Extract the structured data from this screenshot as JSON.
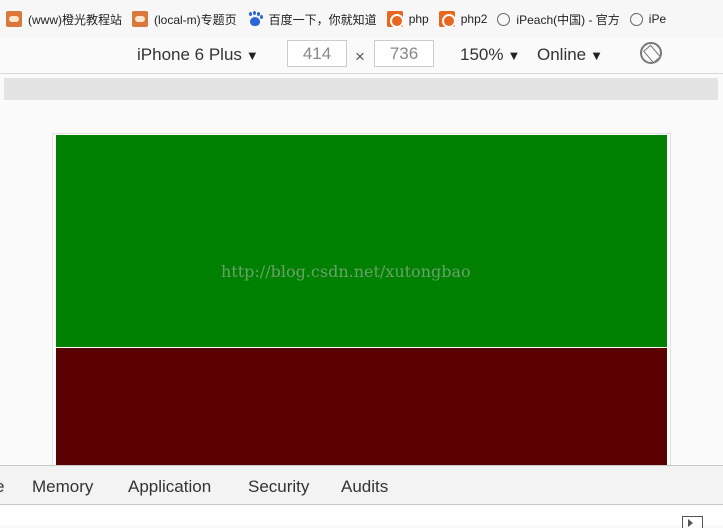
{
  "bookmarks": [
    {
      "icon": "site-face-icon",
      "label": "(www)橙光教程站"
    },
    {
      "icon": "site-face-icon",
      "label": "(local-m)专题页"
    },
    {
      "icon": "baidu-paw-icon",
      "label": "百度一下，你就知道"
    },
    {
      "icon": "php-icon",
      "label": "php"
    },
    {
      "icon": "php-icon",
      "label": "php2"
    },
    {
      "icon": "globe-icon",
      "label": "iPeach(中国) - 官方"
    },
    {
      "icon": "globe-icon",
      "label": "iPe"
    }
  ],
  "device_toolbar": {
    "device": "iPhone 6 Plus",
    "width": "414",
    "times": "×",
    "height": "736",
    "zoom": "150%",
    "network": "Online",
    "caret": "▼"
  },
  "page": {
    "watermark": "http://blog.csdn.net/xutongbao",
    "colors": {
      "top_block": "#008000",
      "bottom_block": "#5b0000"
    }
  },
  "devtools": {
    "tabs": [
      "e",
      "Memory",
      "Application",
      "Security",
      "Audits"
    ]
  }
}
